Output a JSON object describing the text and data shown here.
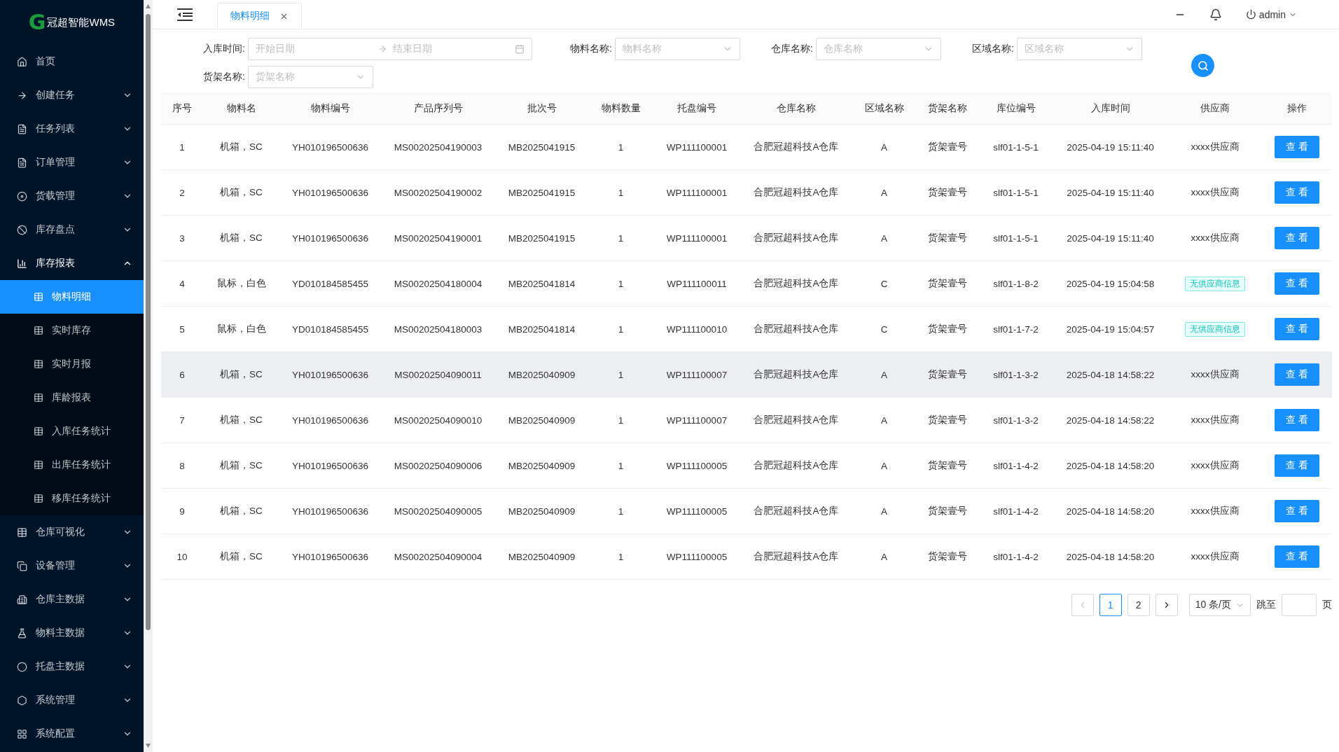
{
  "sidebar": {
    "logo": {
      "mark": "G",
      "text": "冠超智能WMS"
    },
    "items": [
      {
        "label": "首页",
        "expandable": false,
        "expanded": false
      },
      {
        "label": "创建任务",
        "expandable": true,
        "expanded": false
      },
      {
        "label": "任务列表",
        "expandable": true,
        "expanded": false
      },
      {
        "label": "订单管理",
        "expandable": true,
        "expanded": false
      },
      {
        "label": "货载管理",
        "expandable": true,
        "expanded": false
      },
      {
        "label": "库存盘点",
        "expandable": true,
        "expanded": false
      },
      {
        "label": "库存报表",
        "expandable": true,
        "expanded": true,
        "children": [
          {
            "label": "物料明细",
            "selected": true
          },
          {
            "label": "实时库存",
            "selected": false
          },
          {
            "label": "实时月报",
            "selected": false
          },
          {
            "label": "库龄报表",
            "selected": false
          },
          {
            "label": "入库任务统计",
            "selected": false
          },
          {
            "label": "出库任务统计",
            "selected": false
          },
          {
            "label": "移库任务统计",
            "selected": false
          }
        ]
      },
      {
        "label": "仓库可视化",
        "expandable": true,
        "expanded": false
      },
      {
        "label": "设备管理",
        "expandable": true,
        "expanded": false
      },
      {
        "label": "仓库主数据",
        "expandable": true,
        "expanded": false
      },
      {
        "label": "物料主数据",
        "expandable": true,
        "expanded": false
      },
      {
        "label": "托盘主数据",
        "expandable": true,
        "expanded": false
      },
      {
        "label": "系统管理",
        "expandable": true,
        "expanded": false
      },
      {
        "label": "系统配置",
        "expandable": true,
        "expanded": false
      }
    ]
  },
  "tabs": [
    {
      "label": "物料明细",
      "selected": true
    }
  ],
  "header": {
    "user": "admin"
  },
  "filters": {
    "date": {
      "label": "入库时间:",
      "start_placeholder": "开始日期",
      "end_placeholder": "结束日期"
    },
    "selects": [
      {
        "label": "物料名称:",
        "placeholder": "物料名称"
      },
      {
        "label": "仓库名称:",
        "placeholder": "仓库名称"
      },
      {
        "label": "区域名称:",
        "placeholder": "区域名称"
      },
      {
        "label": "货架名称:",
        "placeholder": "货架名称"
      }
    ]
  },
  "table": {
    "columns": [
      "序号",
      "物料名",
      "物料编号",
      "产品序列号",
      "批次号",
      "物料数量",
      "托盘编号",
      "仓库名称",
      "区域名称",
      "货架名称",
      "库位编号",
      "入库时间",
      "供应商",
      "操作"
    ],
    "rows": [
      {
        "highlighted": false,
        "cells": [
          "1",
          "机箱，SC",
          "YH010196500636",
          "MS00202504190003",
          "MB2025041915",
          "1",
          "WP111100001",
          "合肥冠超科技A仓库",
          "A",
          "货架壹号",
          "slf01-1-5-1",
          "2025-04-19 15:11:40"
        ],
        "supplier": {
          "kind": "text",
          "text": "xxxx供应商"
        },
        "action": "查 看"
      },
      {
        "highlighted": false,
        "cells": [
          "2",
          "机箱，SC",
          "YH010196500636",
          "MS00202504190002",
          "MB2025041915",
          "1",
          "WP111100001",
          "合肥冠超科技A仓库",
          "A",
          "货架壹号",
          "slf01-1-5-1",
          "2025-04-19 15:11:40"
        ],
        "supplier": {
          "kind": "text",
          "text": "xxxx供应商"
        },
        "action": "查 看"
      },
      {
        "highlighted": false,
        "cells": [
          "3",
          "机箱，SC",
          "YH010196500636",
          "MS00202504190001",
          "MB2025041915",
          "1",
          "WP111100001",
          "合肥冠超科技A仓库",
          "A",
          "货架壹号",
          "slf01-1-5-1",
          "2025-04-19 15:11:40"
        ],
        "supplier": {
          "kind": "text",
          "text": "xxxx供应商"
        },
        "action": "查 看"
      },
      {
        "highlighted": false,
        "cells": [
          "4",
          "鼠标，白色",
          "YD010184585455",
          "MS00202504180004",
          "MB2025041814",
          "1",
          "WP111100011",
          "合肥冠超科技A仓库",
          "C",
          "货架壹号",
          "slf01-1-8-2",
          "2025-04-19 15:04:58"
        ],
        "supplier": {
          "kind": "tag",
          "text": "无供应商信息"
        },
        "action": "查 看"
      },
      {
        "highlighted": false,
        "cells": [
          "5",
          "鼠标，白色",
          "YD010184585455",
          "MS00202504180003",
          "MB2025041814",
          "1",
          "WP111100010",
          "合肥冠超科技A仓库",
          "C",
          "货架壹号",
          "slf01-1-7-2",
          "2025-04-19 15:04:57"
        ],
        "supplier": {
          "kind": "tag",
          "text": "无供应商信息"
        },
        "action": "查 看"
      },
      {
        "highlighted": true,
        "cells": [
          "6",
          "机箱，SC",
          "YH010196500636",
          "MS00202504090011",
          "MB2025040909",
          "1",
          "WP111100007",
          "合肥冠超科技A仓库",
          "A",
          "货架壹号",
          "slf01-1-3-2",
          "2025-04-18 14:58:22"
        ],
        "supplier": {
          "kind": "text",
          "text": "xxxx供应商"
        },
        "action": "查 看"
      },
      {
        "highlighted": false,
        "cells": [
          "7",
          "机箱，SC",
          "YH010196500636",
          "MS00202504090010",
          "MB2025040909",
          "1",
          "WP111100007",
          "合肥冠超科技A仓库",
          "A",
          "货架壹号",
          "slf01-1-3-2",
          "2025-04-18 14:58:22"
        ],
        "supplier": {
          "kind": "text",
          "text": "xxxx供应商"
        },
        "action": "查 看"
      },
      {
        "highlighted": false,
        "cells": [
          "8",
          "机箱，SC",
          "YH010196500636",
          "MS00202504090006",
          "MB2025040909",
          "1",
          "WP111100005",
          "合肥冠超科技A仓库",
          "A",
          "货架壹号",
          "slf01-1-4-2",
          "2025-04-18 14:58:20"
        ],
        "supplier": {
          "kind": "text",
          "text": "xxxx供应商"
        },
        "action": "查 看"
      },
      {
        "highlighted": false,
        "cells": [
          "9",
          "机箱，SC",
          "YH010196500636",
          "MS00202504090005",
          "MB2025040909",
          "1",
          "WP111100005",
          "合肥冠超科技A仓库",
          "A",
          "货架壹号",
          "slf01-1-4-2",
          "2025-04-18 14:58:20"
        ],
        "supplier": {
          "kind": "text",
          "text": "xxxx供应商"
        },
        "action": "查 看"
      },
      {
        "highlighted": false,
        "cells": [
          "10",
          "机箱，SC",
          "YH010196500636",
          "MS00202504090004",
          "MB2025040909",
          "1",
          "WP111100005",
          "合肥冠超科技A仓库",
          "A",
          "货架壹号",
          "slf01-1-4-2",
          "2025-04-18 14:58:20"
        ],
        "supplier": {
          "kind": "text",
          "text": "xxxx供应商"
        },
        "action": "查 看"
      }
    ]
  },
  "pagination": {
    "pages": [
      {
        "label": "1",
        "selected": true
      },
      {
        "label": "2",
        "selected": false
      }
    ],
    "prev_disabled": true,
    "page_size": "10 条/页",
    "jump_label": "跳至",
    "page_unit": "页"
  }
}
